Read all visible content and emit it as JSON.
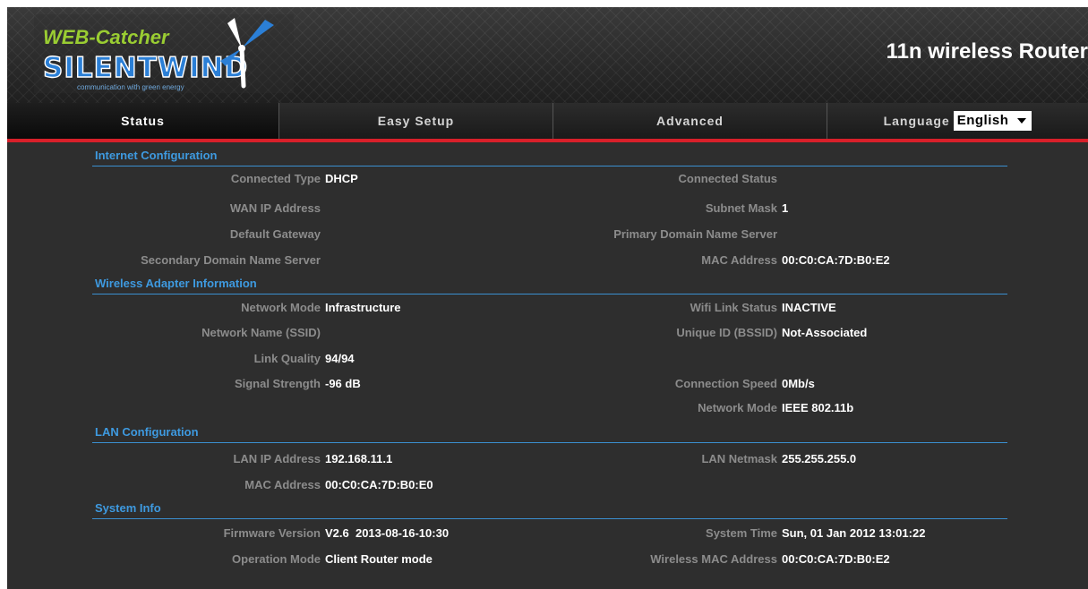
{
  "header": {
    "logo": {
      "brand_top": "WEB-Catcher",
      "brand_main": "SILENTWIND",
      "tagline": "communication with green energy"
    },
    "router_title": "11n wireless Router"
  },
  "nav": {
    "tabs": [
      {
        "label": "Status",
        "active": true
      },
      {
        "label": "Easy Setup",
        "active": false
      },
      {
        "label": "Advanced",
        "active": false
      }
    ],
    "language_label": "Language",
    "language_selected": "English"
  },
  "sections": {
    "internet": {
      "title": "Internet Configuration",
      "connected_type": {
        "label": "Connected Type",
        "value": "DHCP"
      },
      "connected_status": {
        "label": "Connected Status",
        "value": ""
      },
      "wan_ip": {
        "label": "WAN IP Address",
        "value": ""
      },
      "subnet_mask": {
        "label": "Subnet Mask",
        "value": "1"
      },
      "default_gateway": {
        "label": "Default Gateway",
        "value": ""
      },
      "primary_dns": {
        "label": "Primary Domain Name Server",
        "value": ""
      },
      "secondary_dns": {
        "label": "Secondary Domain Name Server",
        "value": ""
      },
      "mac_address": {
        "label": "MAC Address",
        "value": "00:C0:CA:7D:B0:E2"
      }
    },
    "wireless": {
      "title": "Wireless Adapter Information",
      "network_mode": {
        "label": "Network Mode",
        "value": "Infrastructure"
      },
      "wifi_link_status": {
        "label": "Wifi Link Status",
        "value": "INACTIVE"
      },
      "ssid": {
        "label": "Network Name (SSID)",
        "value": ""
      },
      "bssid": {
        "label": "Unique ID (BSSID)",
        "value": "Not-Associated"
      },
      "link_quality": {
        "label": "Link Quality",
        "value": "94/94"
      },
      "signal_strength": {
        "label": "Signal Strength",
        "value": "-96 dB"
      },
      "connection_speed": {
        "label": "Connection Speed",
        "value": "0Mb/s"
      },
      "network_mode_std": {
        "label": "Network Mode",
        "value": "IEEE 802.11b"
      }
    },
    "lan": {
      "title": "LAN Configuration",
      "lan_ip": {
        "label": "LAN IP Address",
        "value": "192.168.11.1"
      },
      "lan_netmask": {
        "label": "LAN Netmask",
        "value": "255.255.255.0"
      },
      "mac_address": {
        "label": "MAC Address",
        "value": "00:C0:CA:7D:B0:E0"
      }
    },
    "system": {
      "title": "System Info",
      "firmware": {
        "label": "Firmware Version",
        "value": "V2.6  2013-08-16-10:30"
      },
      "system_time": {
        "label": "System Time",
        "value": "Sun, 01 Jan 2012 13:01:22"
      },
      "operation_mode": {
        "label": "Operation Mode",
        "value": "Client Router mode"
      },
      "wireless_mac": {
        "label": "Wireless MAC Address",
        "value": "00:C0:CA:7D:B0:E2"
      }
    }
  },
  "colors": {
    "accent_blue": "#3e9ae0",
    "accent_red": "#d8202a",
    "logo_green": "#9acd32",
    "logo_blue": "#2b7fd6"
  }
}
